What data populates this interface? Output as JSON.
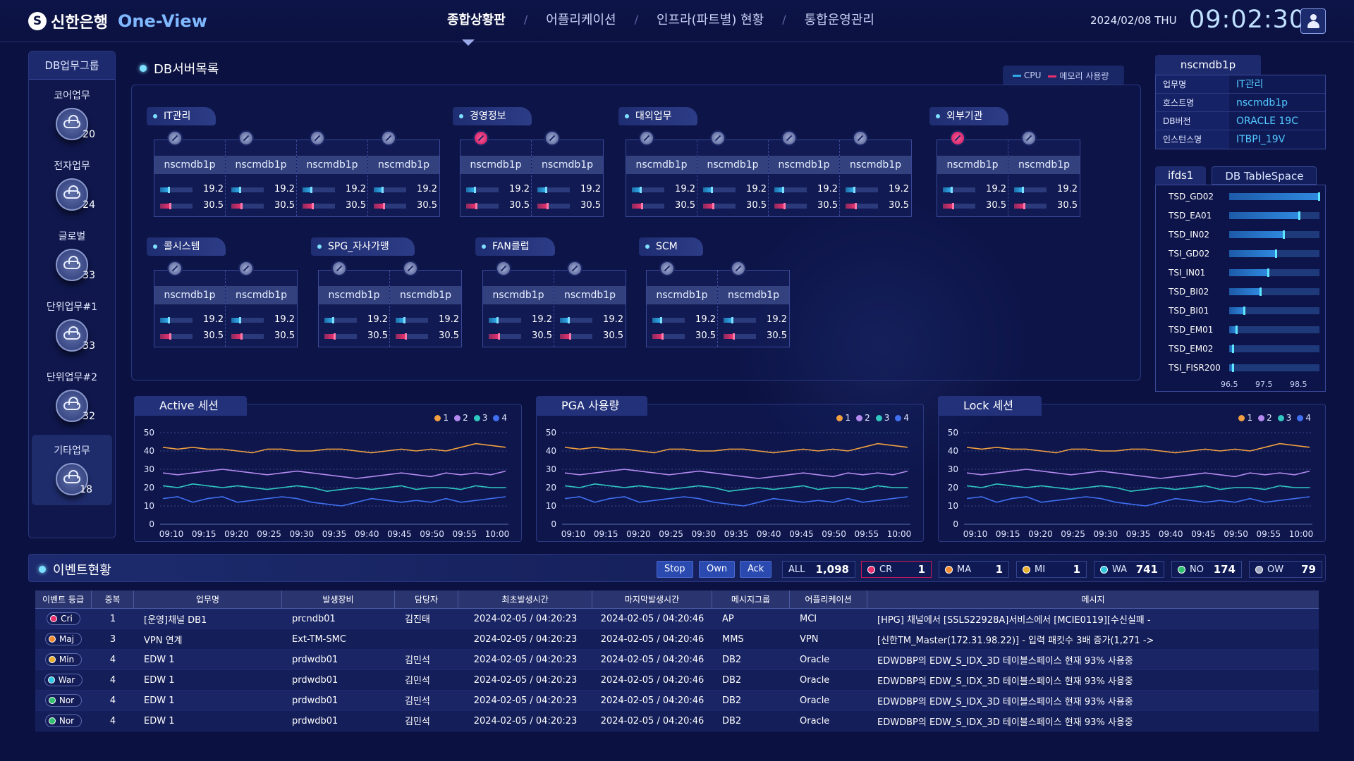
{
  "header": {
    "bank_name": "신한은행",
    "logo_glyph": "S",
    "app_name": "One-View",
    "nav": [
      {
        "label": "종합상황판",
        "active": true
      },
      {
        "label": "어플리케이션",
        "active": false
      },
      {
        "label": "인프라(파트별) 현황",
        "active": false
      },
      {
        "label": "통합운영관리",
        "active": false
      }
    ],
    "date": "2024/02/08 THU",
    "time": "09:02:30"
  },
  "sidebar": {
    "title": "DB업무그룹",
    "items": [
      {
        "label": "코어업무",
        "count": "20"
      },
      {
        "label": "전자업무",
        "count": "24"
      },
      {
        "label": "글로벌",
        "count": "33"
      },
      {
        "label": "단위업무#1",
        "count": "33"
      },
      {
        "label": "단위업무#2",
        "count": "32"
      },
      {
        "label": "기타업무",
        "count": "18",
        "selected": true
      }
    ]
  },
  "db_list": {
    "title": "DB서버목록",
    "legend": {
      "cpu": "CPU",
      "memory": "메모리 사용량",
      "cpu_color": "#2fa8e8",
      "memory_color": "#e8306e"
    },
    "groups": [
      {
        "name": "IT관리",
        "servers": [
          {
            "name": "nscmdb1p",
            "cpu": "19.2",
            "mem": "30.5",
            "alarm": false
          },
          {
            "name": "nscmdb1p",
            "cpu": "19.2",
            "mem": "30.5",
            "alarm": false
          },
          {
            "name": "nscmdb1p",
            "cpu": "19.2",
            "mem": "30.5",
            "alarm": false
          },
          {
            "name": "nscmdb1p",
            "cpu": "19.2",
            "mem": "30.5",
            "alarm": false
          }
        ]
      },
      {
        "name": "경영정보",
        "servers": [
          {
            "name": "nscmdb1p",
            "cpu": "19.2",
            "mem": "30.5",
            "alarm": true
          },
          {
            "name": "nscmdb1p",
            "cpu": "19.2",
            "mem": "30.5",
            "alarm": false
          }
        ]
      },
      {
        "name": "대외업무",
        "servers": [
          {
            "name": "nscmdb1p",
            "cpu": "19.2",
            "mem": "30.5",
            "alarm": false
          },
          {
            "name": "nscmdb1p",
            "cpu": "19.2",
            "mem": "30.5",
            "alarm": false
          },
          {
            "name": "nscmdb1p",
            "cpu": "19.2",
            "mem": "30.5",
            "alarm": false
          },
          {
            "name": "nscmdb1p",
            "cpu": "19.2",
            "mem": "30.5",
            "alarm": false
          }
        ]
      },
      {
        "name": "외부기관",
        "servers": [
          {
            "name": "nscmdb1p",
            "cpu": "19.2",
            "mem": "30.5",
            "alarm": true
          },
          {
            "name": "nscmdb1p",
            "cpu": "19.2",
            "mem": "30.5",
            "alarm": false
          }
        ]
      },
      {
        "name": "콜시스템",
        "servers": [
          {
            "name": "nscmdb1p",
            "cpu": "19.2",
            "mem": "30.5",
            "alarm": false
          },
          {
            "name": "nscmdb1p",
            "cpu": "19.2",
            "mem": "30.5",
            "alarm": false
          }
        ]
      },
      {
        "name": "SPG_자사가맹",
        "servers": [
          {
            "name": "nscmdb1p",
            "cpu": "19.2",
            "mem": "30.5",
            "alarm": false
          },
          {
            "name": "nscmdb1p",
            "cpu": "19.2",
            "mem": "30.5",
            "alarm": false
          }
        ]
      },
      {
        "name": "FAN클럽",
        "servers": [
          {
            "name": "nscmdb1p",
            "cpu": "19.2",
            "mem": "30.5",
            "alarm": false
          },
          {
            "name": "nscmdb1p",
            "cpu": "19.2",
            "mem": "30.5",
            "alarm": false
          }
        ]
      },
      {
        "name": "SCM",
        "servers": [
          {
            "name": "nscmdb1p",
            "cpu": "19.2",
            "mem": "30.5",
            "alarm": false
          },
          {
            "name": "nscmdb1p",
            "cpu": "19.2",
            "mem": "30.5",
            "alarm": false
          }
        ]
      }
    ]
  },
  "server_info": {
    "title": "nscmdb1p",
    "rows": [
      {
        "key": "업무명",
        "value": "IT관리"
      },
      {
        "key": "호스트명",
        "value": "nscmdb1p"
      },
      {
        "key": "DB버전",
        "value": "ORACLE 19C"
      },
      {
        "key": "인스턴스명",
        "value": "ITBPI_19V"
      }
    ]
  },
  "tablespace": {
    "tabs": [
      {
        "label": "ifds1",
        "active": true
      },
      {
        "label": "DB TableSpace",
        "active": false
      }
    ],
    "axis_ticks": [
      "96.5",
      "97.5",
      "98.5"
    ],
    "rows": [
      {
        "name": "TSD_GD02",
        "value": 98.9
      },
      {
        "name": "TSD_EA01",
        "value": 98.3
      },
      {
        "name": "TSD_IN02",
        "value": 97.9
      },
      {
        "name": "TSI_GD02",
        "value": 97.7
      },
      {
        "name": "TSI_IN01",
        "value": 97.5
      },
      {
        "name": "TSD_BI02",
        "value": 97.3
      },
      {
        "name": "TSD_BI01",
        "value": 96.9
      },
      {
        "name": "TSD_EM01",
        "value": 96.7
      },
      {
        "name": "TSD_EM02",
        "value": 96.6
      },
      {
        "name": "TSI_FISR200",
        "value": 96.6
      }
    ]
  },
  "chart_data": [
    {
      "type": "line",
      "title": "Active 세션",
      "x": [
        "09:10",
        "09:15",
        "09:20",
        "09:25",
        "09:30",
        "09:35",
        "09:40",
        "09:45",
        "09:50",
        "09:55",
        "10:00"
      ],
      "ylim": [
        0,
        50
      ],
      "yticks": [
        0,
        10,
        20,
        30,
        40,
        50
      ],
      "series": [
        {
          "name": "1",
          "color": "#f0a040",
          "values": [
            42,
            41,
            42,
            41,
            41,
            40,
            39,
            41,
            41,
            40,
            40,
            41,
            41,
            40,
            39,
            40,
            41,
            40,
            41,
            40,
            42,
            44,
            43,
            42
          ]
        },
        {
          "name": "2",
          "color": "#b48af0",
          "values": [
            28,
            27,
            28,
            29,
            30,
            29,
            28,
            27,
            28,
            29,
            28,
            27,
            26,
            25,
            26,
            27,
            28,
            27,
            26,
            28,
            27,
            28,
            27,
            29
          ]
        },
        {
          "name": "3",
          "color": "#30c8c0",
          "values": [
            21,
            20,
            22,
            21,
            20,
            21,
            20,
            19,
            20,
            21,
            20,
            18,
            19,
            20,
            19,
            20,
            21,
            19,
            20,
            20,
            19,
            21,
            20,
            20
          ]
        },
        {
          "name": "4",
          "color": "#4070f0",
          "values": [
            14,
            15,
            12,
            14,
            15,
            12,
            13,
            14,
            15,
            14,
            12,
            11,
            10,
            12,
            14,
            13,
            12,
            13,
            12,
            14,
            12,
            13,
            14,
            15
          ]
        }
      ]
    },
    {
      "type": "line",
      "title": "PGA 사용량",
      "x": [
        "09:10",
        "09:15",
        "09:20",
        "09:25",
        "09:30",
        "09:35",
        "09:40",
        "09:45",
        "09:50",
        "09:55",
        "10:00"
      ],
      "ylim": [
        0,
        50
      ],
      "yticks": [
        0,
        10,
        20,
        30,
        40,
        50
      ],
      "series": [
        {
          "name": "1",
          "color": "#f0a040",
          "values": [
            42,
            41,
            42,
            41,
            41,
            40,
            39,
            41,
            41,
            40,
            40,
            41,
            41,
            40,
            39,
            40,
            41,
            40,
            41,
            40,
            42,
            44,
            43,
            42
          ]
        },
        {
          "name": "2",
          "color": "#b48af0",
          "values": [
            28,
            27,
            28,
            29,
            30,
            29,
            28,
            27,
            28,
            29,
            28,
            27,
            26,
            25,
            26,
            27,
            28,
            27,
            26,
            28,
            27,
            28,
            27,
            29
          ]
        },
        {
          "name": "3",
          "color": "#30c8c0",
          "values": [
            21,
            20,
            22,
            21,
            20,
            21,
            20,
            19,
            20,
            21,
            20,
            18,
            19,
            20,
            19,
            20,
            21,
            19,
            20,
            20,
            19,
            21,
            20,
            20
          ]
        },
        {
          "name": "4",
          "color": "#4070f0",
          "values": [
            14,
            15,
            12,
            14,
            15,
            12,
            13,
            14,
            15,
            14,
            12,
            11,
            10,
            12,
            14,
            13,
            12,
            13,
            12,
            14,
            12,
            13,
            14,
            15
          ]
        }
      ]
    },
    {
      "type": "line",
      "title": "Lock 세션",
      "x": [
        "09:10",
        "09:15",
        "09:20",
        "09:25",
        "09:30",
        "09:35",
        "09:40",
        "09:45",
        "09:50",
        "09:55",
        "10:00"
      ],
      "ylim": [
        0,
        50
      ],
      "yticks": [
        0,
        10,
        20,
        30,
        40,
        50
      ],
      "series": [
        {
          "name": "1",
          "color": "#f0a040",
          "values": [
            42,
            41,
            42,
            41,
            41,
            40,
            39,
            41,
            41,
            40,
            40,
            41,
            41,
            40,
            39,
            40,
            41,
            40,
            41,
            40,
            42,
            44,
            43,
            42
          ]
        },
        {
          "name": "2",
          "color": "#b48af0",
          "values": [
            28,
            27,
            28,
            29,
            30,
            29,
            28,
            27,
            28,
            29,
            28,
            27,
            26,
            25,
            26,
            27,
            28,
            27,
            26,
            28,
            27,
            28,
            27,
            29
          ]
        },
        {
          "name": "3",
          "color": "#30c8c0",
          "values": [
            21,
            20,
            22,
            21,
            20,
            21,
            20,
            19,
            20,
            21,
            20,
            18,
            19,
            20,
            19,
            20,
            21,
            19,
            20,
            20,
            19,
            21,
            20,
            20
          ]
        },
        {
          "name": "4",
          "color": "#4070f0",
          "values": [
            14,
            15,
            12,
            14,
            15,
            12,
            13,
            14,
            15,
            14,
            12,
            11,
            10,
            12,
            14,
            13,
            12,
            13,
            12,
            14,
            12,
            13,
            14,
            15
          ]
        }
      ]
    }
  ],
  "events": {
    "title": "이벤트현황",
    "buttons": [
      "Stop",
      "Own",
      "Ack"
    ],
    "counters": [
      {
        "label": "ALL",
        "value": "1,098",
        "color": ""
      },
      {
        "label": "CR",
        "value": "1",
        "color": "#e8306e"
      },
      {
        "label": "MA",
        "value": "1",
        "color": "#f08a30"
      },
      {
        "label": "MI",
        "value": "1",
        "color": "#e8b030"
      },
      {
        "label": "WA",
        "value": "741",
        "color": "#30c8e0"
      },
      {
        "label": "NO",
        "value": "174",
        "color": "#30c070"
      },
      {
        "label": "OW",
        "value": "79",
        "color": "#a0a8c0"
      }
    ],
    "columns": [
      "이벤트 등급",
      "중복",
      "업무명",
      "발생장비",
      "담당자",
      "최초발생시간",
      "마지막발생시간",
      "메시지그룹",
      "어플리케이션",
      "메시지"
    ],
    "rows": [
      {
        "grade": "Cri",
        "color": "#e8306e",
        "dup": "1",
        "task": "[운영]채널 DB1",
        "device": "prcndb01",
        "owner": "김진태",
        "first": "2024-02-05 / 04:20:23",
        "last": "2024-02-05 / 04:20:46",
        "group": "AP",
        "app": "MCI",
        "msg": "[HPG] 채널에서 [SSLS22928A]서비스에서 [MCIE0119][수신실패 -"
      },
      {
        "grade": "Maj",
        "color": "#f08a30",
        "dup": "3",
        "task": "VPN 연계",
        "device": "Ext-TM-SMC",
        "owner": "",
        "first": "2024-02-05 / 04:20:23",
        "last": "2024-02-05 / 04:20:46",
        "group": "MMS",
        "app": "VPN",
        "msg": "[신한TM_Master(172.31.98.22)] - 입력 패킷수 3배 증가(1,271 ->"
      },
      {
        "grade": "Min",
        "color": "#e8b030",
        "dup": "4",
        "task": "EDW 1",
        "device": "prdwdb01",
        "owner": "김민석",
        "first": "2024-02-05 / 04:20:23",
        "last": "2024-02-05 / 04:20:46",
        "group": "DB2",
        "app": "Oracle",
        "msg": "EDWDBP의 EDW_S_IDX_3D 테이블스페이스 현재 93% 사용중"
      },
      {
        "grade": "War",
        "color": "#30c8e0",
        "dup": "4",
        "task": "EDW 1",
        "device": "prdwdb01",
        "owner": "김민석",
        "first": "2024-02-05 / 04:20:23",
        "last": "2024-02-05 / 04:20:46",
        "group": "DB2",
        "app": "Oracle",
        "msg": "EDWDBP의 EDW_S_IDX_3D 테이블스페이스 현재 93% 사용중"
      },
      {
        "grade": "Nor",
        "color": "#30c070",
        "dup": "4",
        "task": "EDW 1",
        "device": "prdwdb01",
        "owner": "김민석",
        "first": "2024-02-05 / 04:20:23",
        "last": "2024-02-05 / 04:20:46",
        "group": "DB2",
        "app": "Oracle",
        "msg": "EDWDBP의 EDW_S_IDX_3D 테이블스페이스 현재 93% 사용중"
      },
      {
        "grade": "Nor",
        "color": "#30c070",
        "dup": "4",
        "task": "EDW 1",
        "device": "prdwdb01",
        "owner": "김민석",
        "first": "2024-02-05 / 04:20:23",
        "last": "2024-02-05 / 04:20:46",
        "group": "DB2",
        "app": "Oracle",
        "msg": "EDWDBP의 EDW_S_IDX_3D 테이블스페이스 현재 93% 사용중"
      }
    ]
  }
}
